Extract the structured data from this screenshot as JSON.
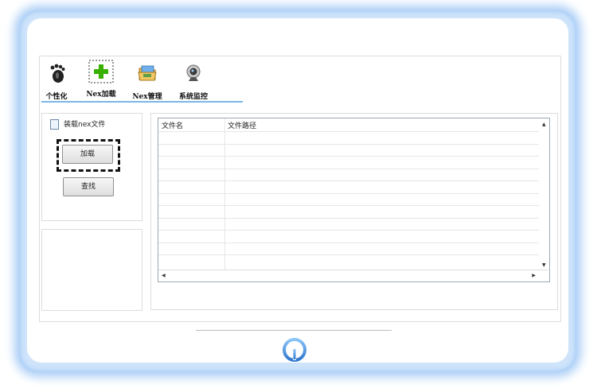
{
  "toolbar": {
    "items": [
      {
        "label": "个性化",
        "icon": "footprint-icon"
      },
      {
        "label": "Nex加载",
        "icon": "plus-icon"
      },
      {
        "label": "Nex管理",
        "icon": "folder-icon"
      },
      {
        "label": "系统监控",
        "icon": "webcam-icon"
      }
    ]
  },
  "left_panel": {
    "title": "装载nex文件",
    "load_button": "加载",
    "find_button": "查找"
  },
  "file_table": {
    "columns": [
      "文件名",
      "文件路径"
    ],
    "rows": []
  },
  "colors": {
    "frame_glow": "#a9cdf6",
    "accent_line": "#7ab6e8",
    "plus_green": "#38b000",
    "logo_blue": "#3d8be0"
  }
}
